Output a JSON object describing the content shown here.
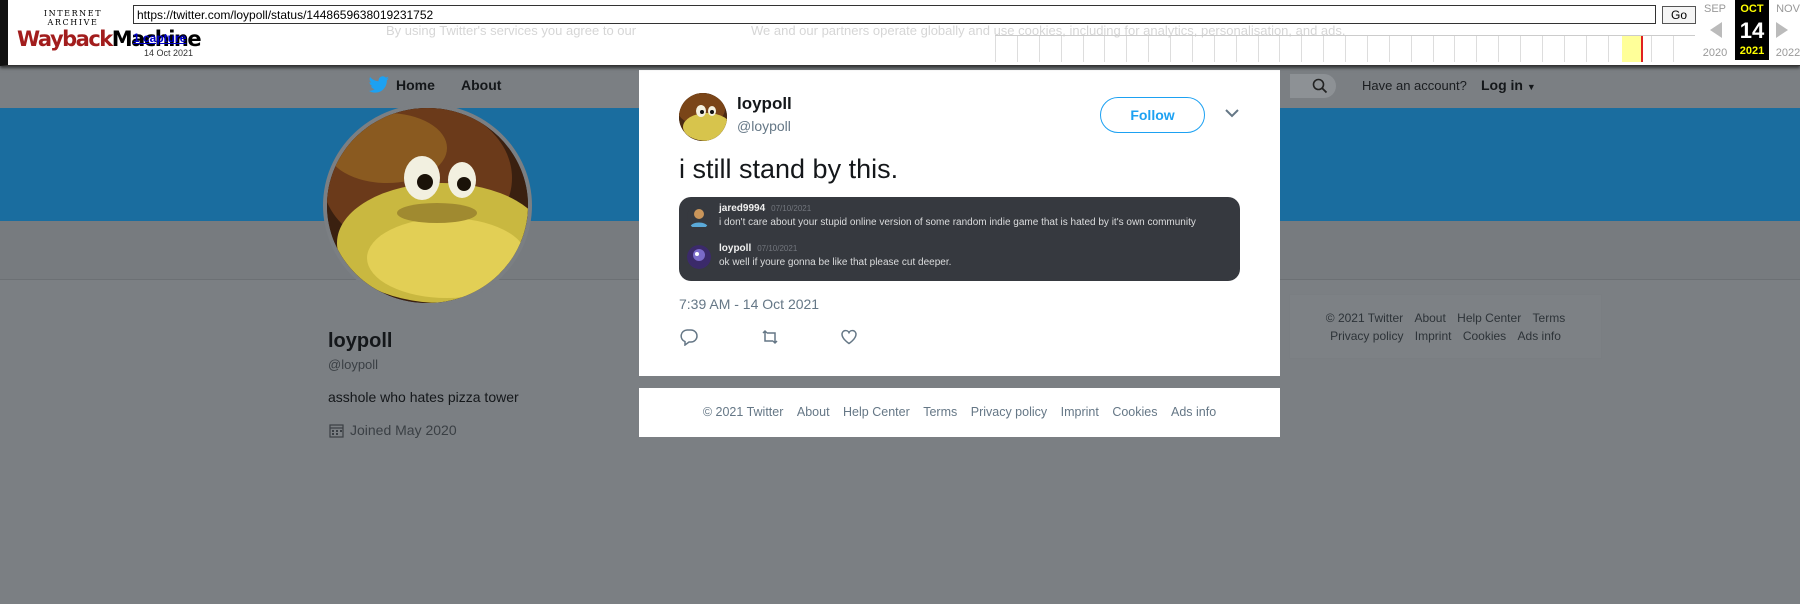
{
  "wayback": {
    "logo_top": "INTERNET ARCHIVE",
    "logo_main_a": "Wayback",
    "logo_main_b": "Machine",
    "url": "https://twitter.com/loypoll/status/1448659638019231752",
    "go_label": "Go",
    "captures_link": "1 capture",
    "capture_date": "14 Oct 2021",
    "bleed_text_1": "By using Twitter's services you agree to our",
    "bleed_text_2": "We and our partners operate globally and use cookies, including for analytics, personalisation, and ads.",
    "prev_month": "SEP",
    "current_month": "OCT",
    "next_month": "NOV",
    "current_day": "14",
    "prev_year": "2020",
    "current_year": "2021",
    "next_year": "2022",
    "accent_color": "#a21d1d",
    "highlight_color": "#ffff99"
  },
  "nav": {
    "home_label": "Home",
    "about_label": "About",
    "have_account": "Have an account?",
    "login_label": "Log in",
    "bird_icon": "twitter-bird-icon",
    "search_icon": "search-icon"
  },
  "profile": {
    "name": "loypoll",
    "handle": "@loypoll",
    "bio": "asshole who hates pizza tower",
    "joined": "Joined May 2020",
    "banner_color": "#1a6d9f"
  },
  "side_footer": {
    "row1": [
      "© 2021 Twitter",
      "About",
      "Help Center",
      "Terms"
    ],
    "row2": [
      "Privacy policy",
      "Imprint",
      "Cookies",
      "Ads info"
    ]
  },
  "tweet": {
    "name": "loypoll",
    "handle": "@loypoll",
    "follow_label": "Follow",
    "text": "i still stand by this.",
    "timestamp": "7:39 AM - 14 Oct 2021",
    "media": {
      "messages": [
        {
          "user": "jared9994",
          "date": "07/10/2021",
          "text": "i don't care about your stupid online version of some random indie game that is hated by it's own community"
        },
        {
          "user": "loypoll",
          "date": "07/10/2021",
          "text": "ok well if youre gonna be like that please cut deeper."
        }
      ]
    },
    "accent_color": "#1da1f2"
  },
  "modal_footer": {
    "links": [
      "© 2021 Twitter",
      "About",
      "Help Center",
      "Terms",
      "Privacy policy",
      "Imprint",
      "Cookies",
      "Ads info"
    ]
  }
}
